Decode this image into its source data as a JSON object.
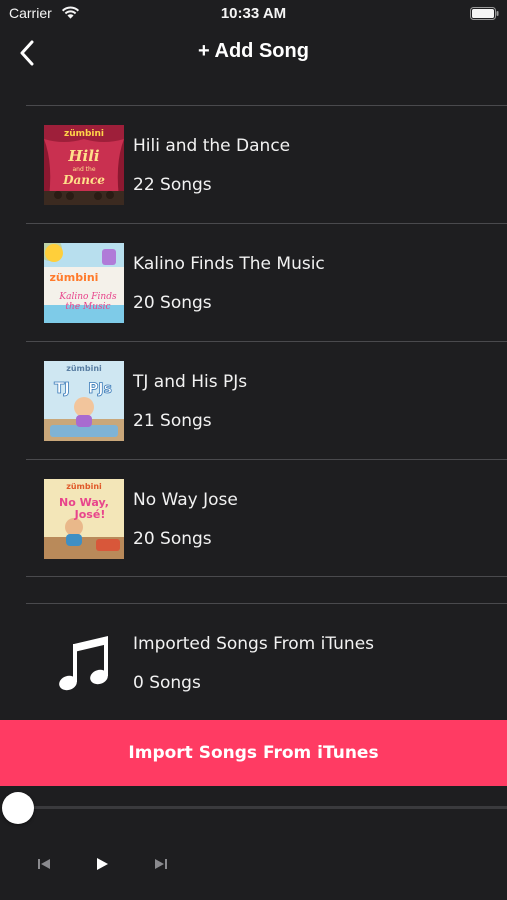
{
  "status_bar": {
    "carrier": "Carrier",
    "time": "10:33 AM",
    "icons": [
      "wifi-icon",
      "battery-icon"
    ]
  },
  "nav": {
    "title": "+ Add Song",
    "back_icon": "chevron-left-icon"
  },
  "albums": [
    {
      "title": "Hili and the Dance",
      "count": "22 Songs",
      "cover_brand": "zümbini",
      "cover_text": "Hili and the Dance"
    },
    {
      "title": "Kalino Finds The Music",
      "count": "20 Songs",
      "cover_brand": "zümbini",
      "cover_text": "Kalino Finds the Music"
    },
    {
      "title": "TJ and His PJs",
      "count": "21 Songs",
      "cover_brand": "zümbini",
      "cover_text": "TJ and His PJs"
    },
    {
      "title": "No Way Jose",
      "count": "20 Songs",
      "cover_brand": "zümbini",
      "cover_text": "No Way, José!"
    }
  ],
  "itunes": {
    "title": "Imported Songs From iTunes",
    "count": "0 Songs",
    "icon": "music-note-icon"
  },
  "import_button": {
    "label": "Import Songs From iTunes"
  },
  "player": {
    "progress": 0,
    "controls": [
      "previous-icon",
      "play-icon",
      "next-icon"
    ]
  },
  "colors": {
    "background": "#1e1e20",
    "accent": "#ff3b63",
    "divider": "#4a4a4d",
    "text": "#f2f2f2"
  }
}
